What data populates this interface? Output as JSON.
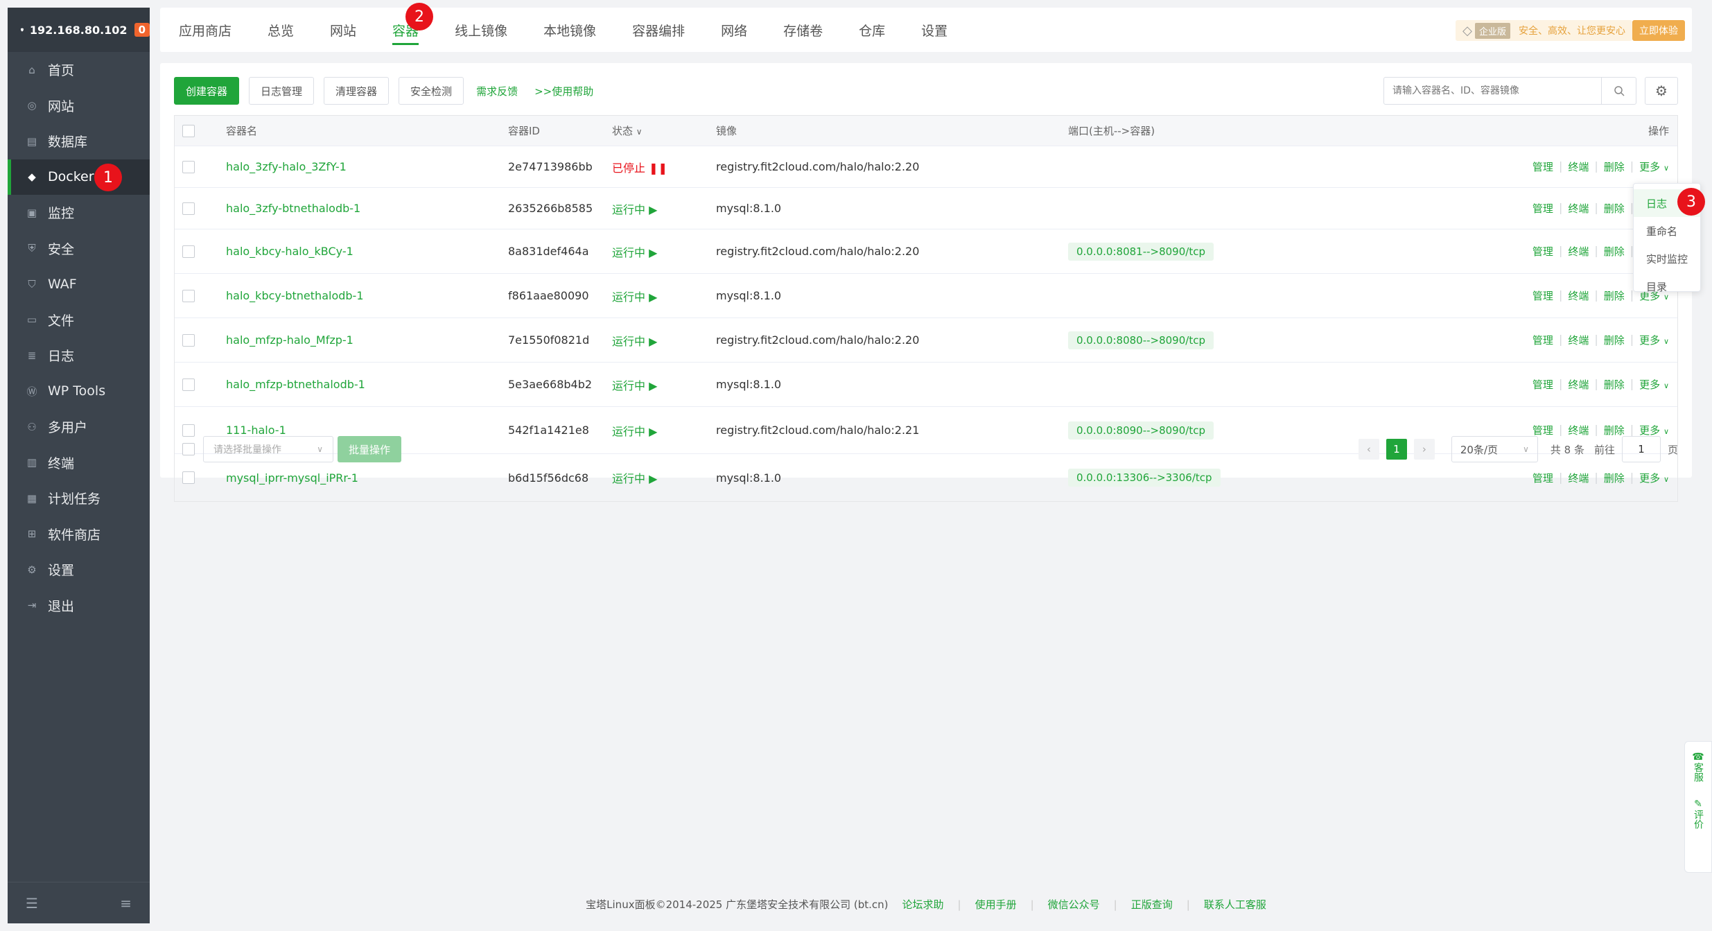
{
  "sidebar": {
    "server_ip": "192.168.80.102",
    "badge_count": "0",
    "items": [
      {
        "label": "首页",
        "icon": "home-icon"
      },
      {
        "label": "网站",
        "icon": "globe-icon"
      },
      {
        "label": "数据库",
        "icon": "database-icon"
      },
      {
        "label": "Docker",
        "icon": "docker-icon"
      },
      {
        "label": "监控",
        "icon": "monitor-icon"
      },
      {
        "label": "安全",
        "icon": "shield-icon"
      },
      {
        "label": "WAF",
        "icon": "waf-icon"
      },
      {
        "label": "文件",
        "icon": "folder-icon"
      },
      {
        "label": "日志",
        "icon": "log-icon"
      },
      {
        "label": "WP Tools",
        "icon": "wordpress-icon"
      },
      {
        "label": "多用户",
        "icon": "users-icon"
      },
      {
        "label": "终端",
        "icon": "terminal-icon"
      },
      {
        "label": "计划任务",
        "icon": "calendar-icon"
      },
      {
        "label": "软件商店",
        "icon": "apps-icon"
      },
      {
        "label": "设置",
        "icon": "settings-icon"
      },
      {
        "label": "退出",
        "icon": "logout-icon"
      }
    ],
    "active_index": 3
  },
  "markers": [
    "1",
    "2",
    "3"
  ],
  "topnav": {
    "tabs": [
      "应用商店",
      "总览",
      "网站",
      "容器",
      "线上镜像",
      "本地镜像",
      "容器编排",
      "网络",
      "存储卷",
      "仓库",
      "设置"
    ],
    "active_index": 3,
    "enterprise_tag": "企业版",
    "slogan": "安全、高效、让您更安心",
    "try_button": "立即体验"
  },
  "toolbar": {
    "create_button": "创建容器",
    "log_button": "日志管理",
    "clean_button": "清理容器",
    "security_button": "安全检测",
    "feedback_link": "需求反馈",
    "help_link": ">>使用帮助",
    "search_placeholder": "请输入容器名、ID、容器镜像"
  },
  "table": {
    "headers": {
      "name": "容器名",
      "id": "容器ID",
      "status": "状态",
      "image": "镜像",
      "port": "端口(主机-->容器)",
      "ops": "操作"
    },
    "ops_labels": {
      "manage": "管理",
      "terminal": "终端",
      "delete": "删除",
      "more": "更多"
    },
    "rows": [
      {
        "name": "halo_3zfy-halo_3ZfY-1",
        "id": "2e74713986bb",
        "status": "已停止",
        "running": false,
        "image": "registry.fit2cloud.com/halo/halo:2.20",
        "port": ""
      },
      {
        "name": "halo_3zfy-btnethalodb-1",
        "id": "2635266b8585",
        "status": "运行中",
        "running": true,
        "image": "mysql:8.1.0",
        "port": ""
      },
      {
        "name": "halo_kbcy-halo_kBCy-1",
        "id": "8a831def464a",
        "status": "运行中",
        "running": true,
        "image": "registry.fit2cloud.com/halo/halo:2.20",
        "port": "0.0.0.0:8081-->8090/tcp"
      },
      {
        "name": "halo_kbcy-btnethalodb-1",
        "id": "f861aae80090",
        "status": "运行中",
        "running": true,
        "image": "mysql:8.1.0",
        "port": ""
      },
      {
        "name": "halo_mfzp-halo_Mfzp-1",
        "id": "7e1550f0821d",
        "status": "运行中",
        "running": true,
        "image": "registry.fit2cloud.com/halo/halo:2.20",
        "port": "0.0.0.0:8080-->8090/tcp"
      },
      {
        "name": "halo_mfzp-btnethalodb-1",
        "id": "5e3ae668b4b2",
        "status": "运行中",
        "running": true,
        "image": "mysql:8.1.0",
        "port": ""
      },
      {
        "name": "111-halo-1",
        "id": "542f1a1421e8",
        "status": "运行中",
        "running": true,
        "image": "registry.fit2cloud.com/halo/halo:2.21",
        "port": "0.0.0.0:8090-->8090/tcp"
      },
      {
        "name": "mysql_iprr-mysql_iPRr-1",
        "id": "b6d15f56dc68",
        "status": "运行中",
        "running": true,
        "image": "mysql:8.1.0",
        "port": "0.0.0.0:13306-->3306/tcp"
      }
    ]
  },
  "more_menu": [
    "日志",
    "重命名",
    "实时监控",
    "目录"
  ],
  "batch": {
    "select_placeholder": "请选择批量操作",
    "button": "批量操作"
  },
  "pager": {
    "current": "1",
    "page_size": "20条/页",
    "total": "共 8 条",
    "goto_label": "前往",
    "goto_value": "1",
    "page_suffix": "页"
  },
  "footer": {
    "copyright": "宝塔Linux面板©2014-2025 广东堡塔安全技术有限公司 (bt.cn)",
    "links": [
      "论坛求助",
      "使用手册",
      "微信公众号",
      "正版查询",
      "联系人工客服"
    ]
  },
  "float_service": {
    "service": "客服",
    "review": "评价"
  },
  "colors": {
    "brand": "#20a53a",
    "danger": "#e8131b",
    "sidebar": "#3c444d"
  }
}
